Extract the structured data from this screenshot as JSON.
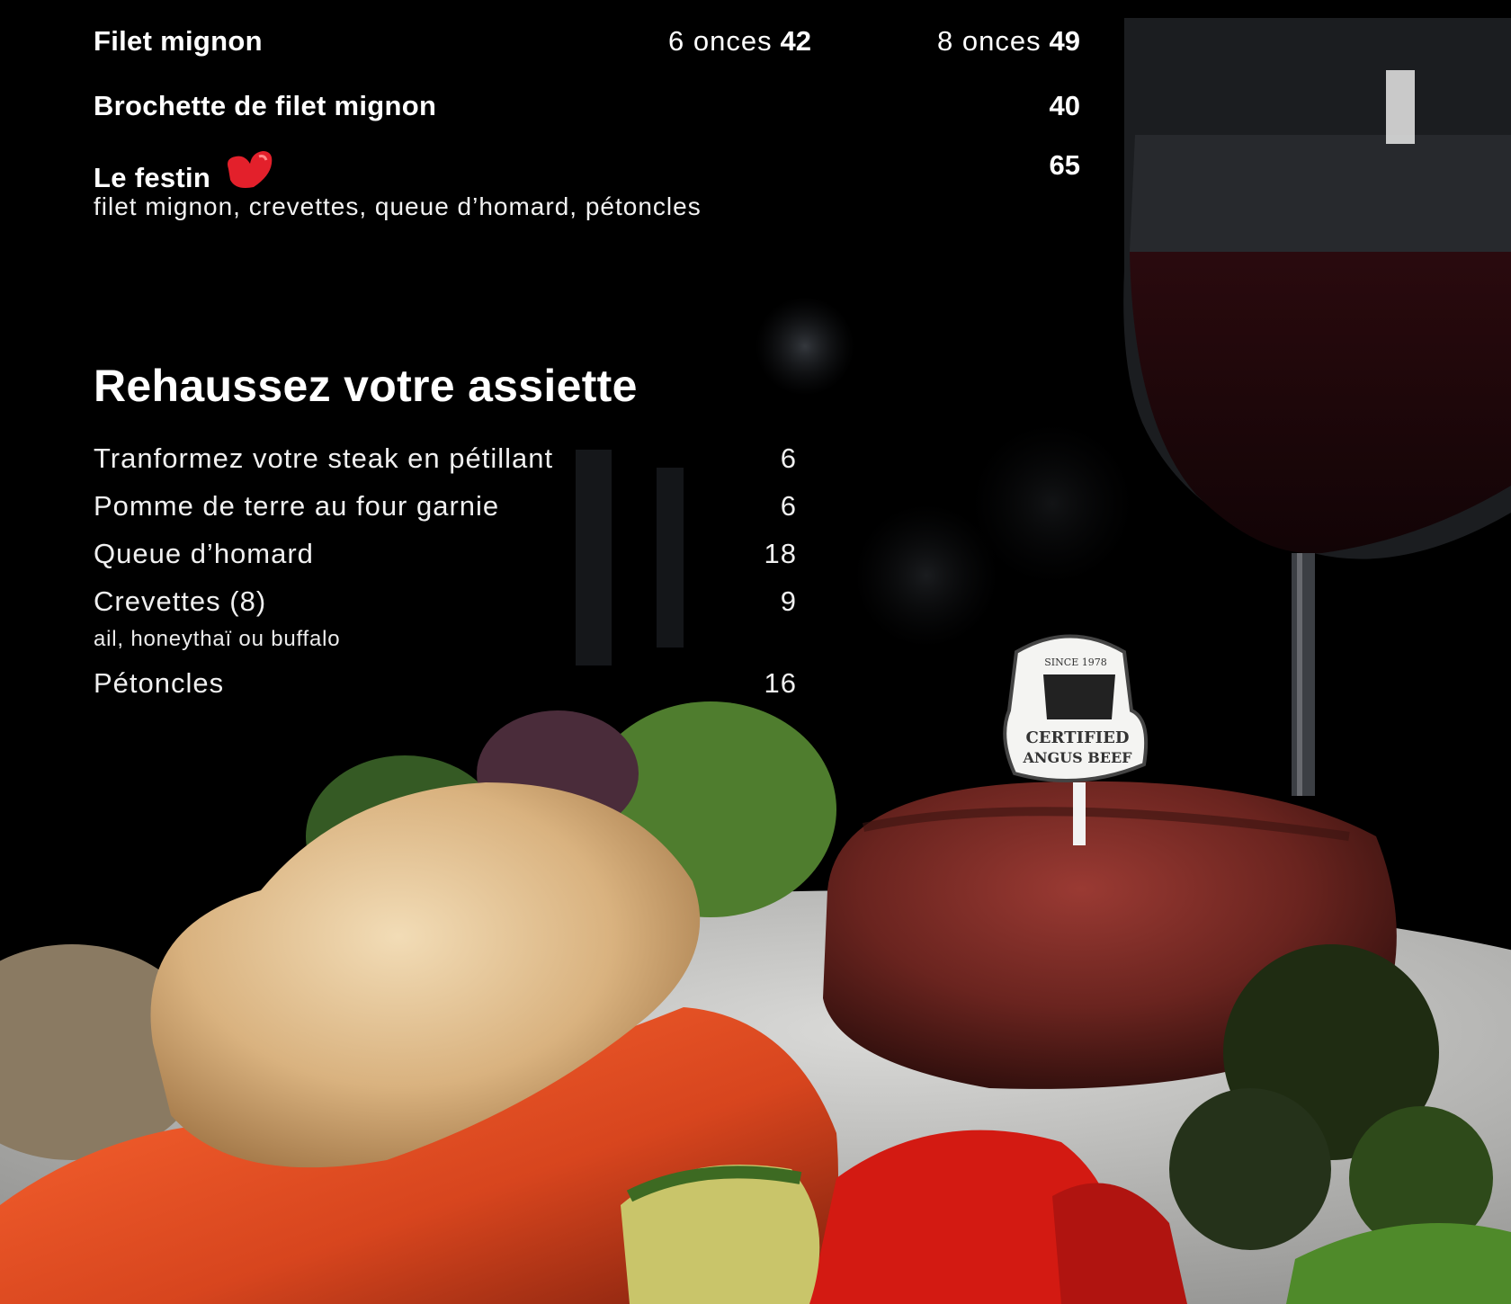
{
  "menu_items": [
    {
      "name": "Filet mignon",
      "size1_label": "6 onces",
      "size1_price": "42",
      "size2_label": "8 onces",
      "size2_price": "49"
    },
    {
      "name": "Brochette de filet mignon",
      "price": "40"
    },
    {
      "name": "Le festin",
      "price": "65",
      "description": "filet mignon, crevettes, queue d’homard, pétoncles",
      "badge_icon": "heart-icon",
      "badge_color": "#e3202b"
    }
  ],
  "addons_section": {
    "title": "Rehaussez votre assiette",
    "items": [
      {
        "name": "Tranformez votre steak en pétillant",
        "price": "6"
      },
      {
        "name": "Pomme de terre au four garnie",
        "price": "6"
      },
      {
        "name": "Queue d’homard",
        "price": "18"
      },
      {
        "name": "Crevettes (8)",
        "price": "9",
        "note": "ail, honeythaï ou buffalo"
      },
      {
        "name": "Pétoncles",
        "price": "16"
      }
    ]
  },
  "photo": {
    "tag_text": [
      "SINCE 1978",
      "CERTIFIED",
      "ANGUS BEEF"
    ]
  },
  "colors": {
    "background": "#000000",
    "text": "#ffffff",
    "accent": "#e3202b"
  }
}
